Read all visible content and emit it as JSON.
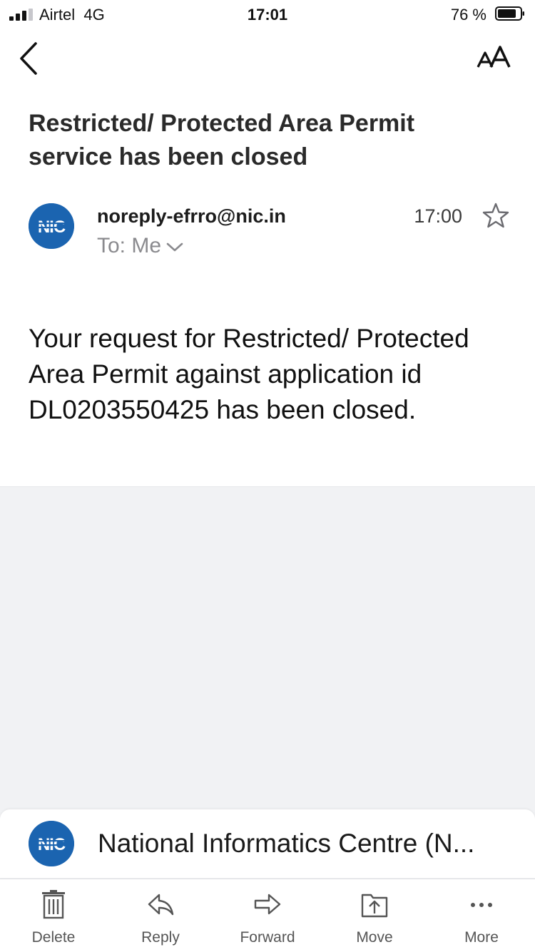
{
  "status_bar": {
    "carrier": "Airtel",
    "network": "4G",
    "time": "17:01",
    "battery": "76 %"
  },
  "header": {
    "back_icon": "chevron-left-icon",
    "text_size_label": "AA"
  },
  "email": {
    "subject": "Restricted/ Protected Area Permit service has been closed",
    "sender": "noreply-efrro@nic.in",
    "recipient": "To: Me",
    "time": "17:00",
    "avatar_label": "NIC",
    "body": "Your request for Restricted/ Protected Area Permit against application id DL0203550425 has been closed."
  },
  "card": {
    "title": "National Informatics Centre (N..."
  },
  "toolbar": {
    "items": [
      {
        "label": "Delete",
        "icon": "trash-icon"
      },
      {
        "label": "Reply",
        "icon": "reply-icon"
      },
      {
        "label": "Forward",
        "icon": "forward-icon"
      },
      {
        "label": "Move",
        "icon": "move-icon"
      },
      {
        "label": "More",
        "icon": "more-icon"
      }
    ]
  },
  "colors": {
    "accent": "#1b64b0",
    "background_grey": "#f1f2f4"
  }
}
